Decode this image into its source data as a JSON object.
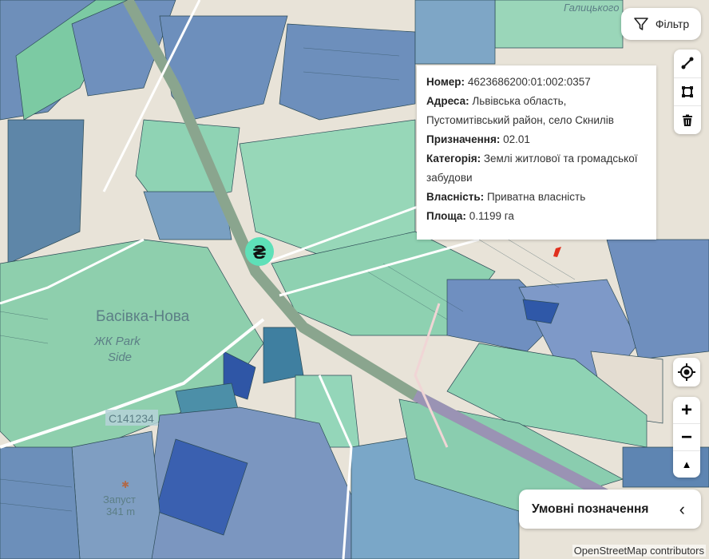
{
  "map": {
    "labels": {
      "street_top": "Галицького",
      "village": "Басівка-Нова",
      "complex_line1": "ЖК Park",
      "complex_line2": "Side",
      "road_code": "С141234",
      "peak_name": "Запуст",
      "peak_elev": "341 m"
    },
    "currency_marker": "₴",
    "colors": {
      "parcel_green": "#8fd3b4",
      "parcel_blue": "#7b96c0",
      "parcel_dark_blue": "#3d63b3",
      "selected_parcel": "#e0301e"
    }
  },
  "filter": {
    "label": "Фільтр",
    "icon": "funnel-icon"
  },
  "draw_tools": [
    {
      "name": "line-tool",
      "icon": "line-icon"
    },
    {
      "name": "polygon-tool",
      "icon": "square-icon"
    },
    {
      "name": "delete-tool",
      "icon": "trash-icon"
    }
  ],
  "popup": {
    "number_label": "Номер:",
    "number": "4623686200:01:002:0357",
    "address_label": "Адреса:",
    "address": "Львівська область, Пустомитівський район, село Скнилів",
    "purpose_label": "Призначення:",
    "purpose": "02.01",
    "category_label": "Категорія:",
    "category": "Землі житлової та громадської забудови",
    "ownership_label": "Власність:",
    "ownership": "Приватна власність",
    "area_label": "Площа:",
    "area": "0.1199 га"
  },
  "controls": {
    "zoom_in": "+",
    "zoom_out": "−",
    "compass": "▲"
  },
  "legend": {
    "label": "Умовні позначення",
    "chevron": "‹"
  },
  "attribution": "OpenStreetMap contributors"
}
